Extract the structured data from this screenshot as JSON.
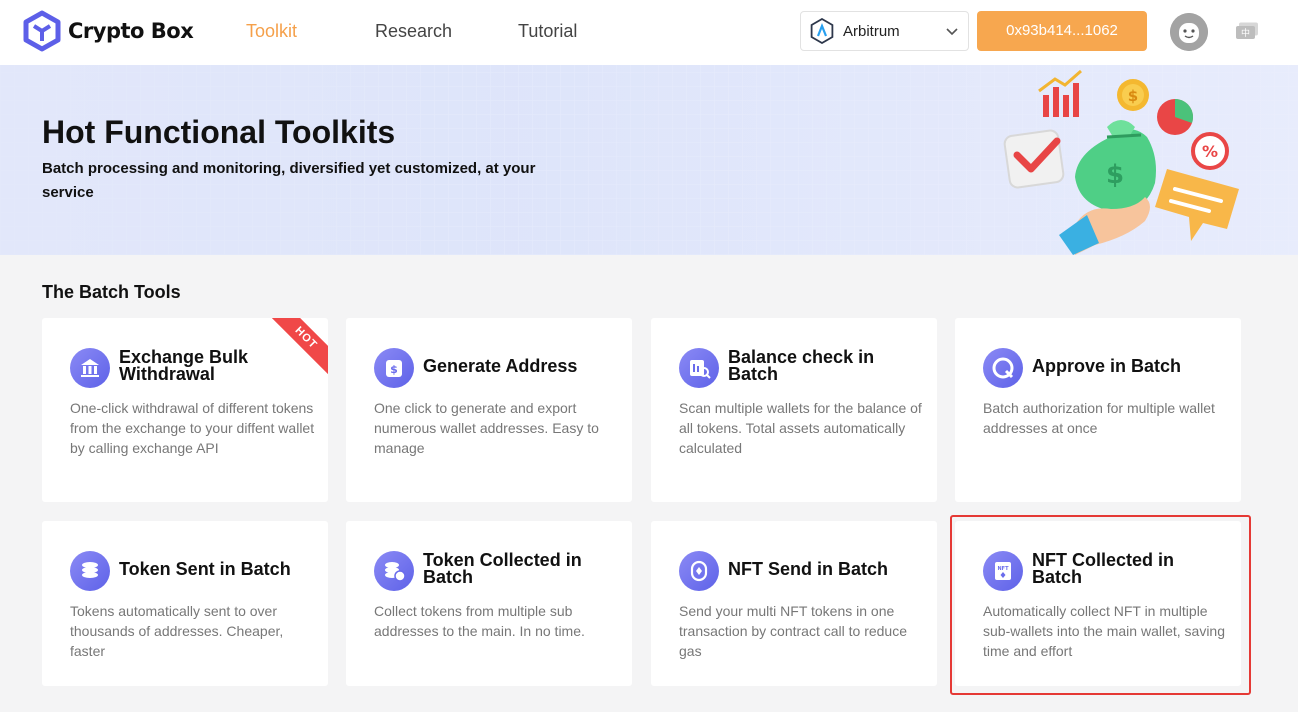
{
  "brand": {
    "name": "Crypto Box",
    "icon": "cube-logo-icon"
  },
  "nav": [
    {
      "label": "Toolkit",
      "active": true
    },
    {
      "label": "Research",
      "active": false
    },
    {
      "label": "Tutorial",
      "active": false
    }
  ],
  "network": {
    "label": "Arbitrum",
    "icon": "arbitrum-icon"
  },
  "wallet": {
    "address": "0x93b414...1062"
  },
  "colors": {
    "accent": "#f7a74f",
    "active_nav": "#f5a04a",
    "icon_gradient": [
      "#8b8af5",
      "#5e62e8"
    ],
    "hot": "#f04848",
    "highlight": "#e53935"
  },
  "banner": {
    "title": "Hot Functional Toolkits",
    "subtitle": "Batch processing and monitoring, diversified yet customized, at your service"
  },
  "section": {
    "title": "The Batch Tools"
  },
  "cards": [
    {
      "title": "Exchange Bulk Withdrawal",
      "desc": "One-click withdrawal of different tokens from the exchange to your diffent wallet by calling exchange API",
      "badge": "HOT",
      "icon": "bank-withdraw-icon"
    },
    {
      "title": "Generate Address",
      "desc": "One click to generate and export numerous wallet addresses. Easy to manage",
      "icon": "wallet-generate-icon"
    },
    {
      "title": "Balance check in Batch",
      "desc": "Scan multiple wallets for the balance of all tokens. Total assets automatically calculated",
      "icon": "balance-scan-icon"
    },
    {
      "title": "Approve in Batch",
      "desc": "Batch authorization for multiple wallet addresses at once",
      "icon": "approve-icon"
    },
    {
      "title": "Token Sent in Batch",
      "desc": "Tokens automatically sent to over thousands of addresses. Cheaper, faster",
      "icon": "coins-send-icon"
    },
    {
      "title": "Token Collected in Batch",
      "desc": "Collect tokens from multiple sub addresses to the main. In no time.",
      "icon": "coins-collect-icon"
    },
    {
      "title": "NFT Send in Batch",
      "desc": "Send your multi NFT tokens in one transaction by contract call to reduce gas",
      "icon": "nft-send-icon"
    },
    {
      "title": "NFT Collected in Batch",
      "desc": "Automatically collect NFT in multiple sub-wallets into the main wallet, saving time and effort",
      "icon": "nft-collect-icon",
      "highlighted": true
    }
  ]
}
